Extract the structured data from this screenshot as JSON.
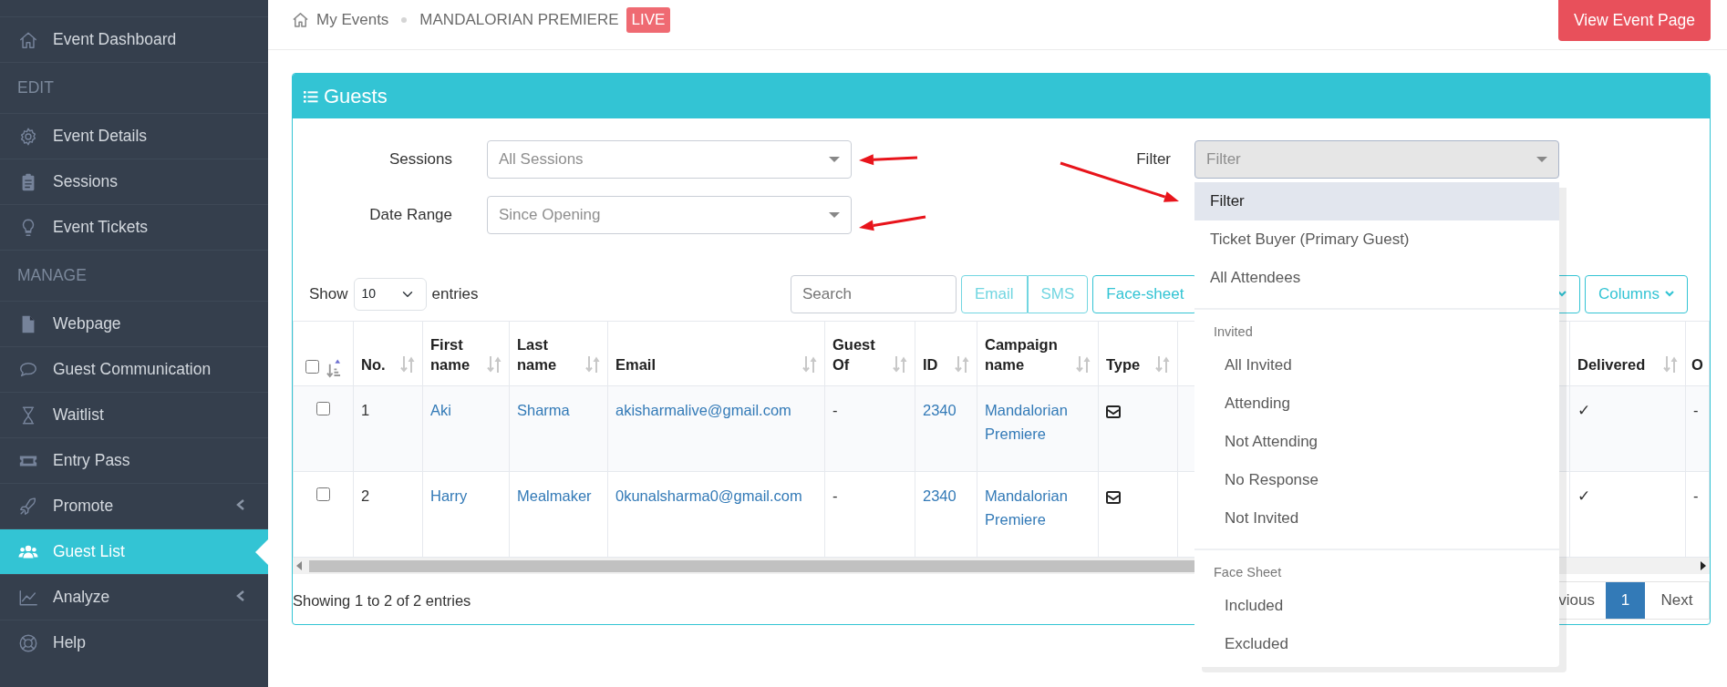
{
  "sidebar": {
    "items": [
      {
        "kind": "link",
        "label": "Event Dashboard",
        "selected": false,
        "submenu": false
      },
      {
        "kind": "heading",
        "label": "EDIT"
      },
      {
        "kind": "link",
        "label": "Event Details",
        "selected": false,
        "submenu": false
      },
      {
        "kind": "link",
        "label": "Sessions",
        "selected": false,
        "submenu": false
      },
      {
        "kind": "link",
        "label": "Event Tickets",
        "selected": false,
        "submenu": false
      },
      {
        "kind": "heading",
        "label": "MANAGE"
      },
      {
        "kind": "link",
        "label": "Webpage",
        "selected": false,
        "submenu": false
      },
      {
        "kind": "link",
        "label": "Guest Communication",
        "selected": false,
        "submenu": false
      },
      {
        "kind": "link",
        "label": "Waitlist",
        "selected": false,
        "submenu": false
      },
      {
        "kind": "link",
        "label": "Entry Pass",
        "selected": false,
        "submenu": false
      },
      {
        "kind": "link",
        "label": "Promote",
        "selected": false,
        "submenu": true
      },
      {
        "kind": "link",
        "label": "Guest List",
        "selected": true,
        "submenu": false
      },
      {
        "kind": "link",
        "label": "Analyze",
        "selected": false,
        "submenu": true
      },
      {
        "kind": "link",
        "label": "Help",
        "selected": false,
        "submenu": false
      }
    ]
  },
  "breadcrumb": {
    "items": [
      {
        "label": "My Events"
      },
      {
        "label": "MANDALORIAN PREMIERE"
      }
    ],
    "badge": "LIVE"
  },
  "header_button": "View Event Page",
  "card": {
    "title": "Guests",
    "selects": [
      {
        "label": "Sessions",
        "placeholder": "All Sessions"
      },
      {
        "label": "Date Range",
        "placeholder": "Since Opening"
      }
    ],
    "filter": {
      "label": "Filter",
      "placeholder": "Filter",
      "expanded": true,
      "groups": [
        {
          "options": [
            {
              "label": "Filter",
              "selected": true
            },
            {
              "label": "Ticket Buyer (Primary Guest)",
              "selected": false
            },
            {
              "label": "All Attendees",
              "selected": false
            }
          ]
        },
        {
          "header": "Invited",
          "options": [
            {
              "label": "All Invited",
              "selected": false
            },
            {
              "label": "Attending",
              "selected": false
            },
            {
              "label": "Not Attending",
              "selected": false
            },
            {
              "label": "No Response",
              "selected": false
            },
            {
              "label": "Not Invited",
              "selected": false
            }
          ]
        },
        {
          "header": "Face Sheet",
          "options": [
            {
              "label": "Included",
              "selected": false
            },
            {
              "label": "Excluded",
              "selected": false
            }
          ]
        }
      ]
    },
    "length": {
      "before": "Show",
      "value": "10",
      "after": "entries"
    },
    "search": {
      "placeholder": "Search"
    },
    "buttons": [
      {
        "kind": "grouped",
        "label": "Email"
      },
      {
        "kind": "grouped",
        "label": "SMS"
      },
      {
        "kind": "single",
        "label": "Face-sheet"
      },
      {
        "kind": "caret-only"
      },
      {
        "kind": "dropdown",
        "label": "Columns"
      }
    ],
    "table": {
      "select_all": {
        "checked": false
      },
      "columns": [
        {
          "kind": "text",
          "label": "No."
        },
        {
          "kind": "link",
          "label": "First name"
        },
        {
          "kind": "link",
          "label": "Last name"
        },
        {
          "kind": "link",
          "label": "Email"
        },
        {
          "kind": "text",
          "label": "Guest Of"
        },
        {
          "kind": "link",
          "label": "ID"
        },
        {
          "kind": "link",
          "label": "Campaign name"
        },
        {
          "kind": "icon",
          "label": "Type"
        },
        {
          "kind": "hidden"
        },
        {
          "kind": "text",
          "label": "Delivered"
        },
        {
          "kind": "text",
          "label": "O"
        }
      ],
      "rows": [
        {
          "checked": false,
          "cells": [
            "1",
            "Aki",
            "Sharma",
            "akisharmalive@gmail.com",
            "-",
            "2340",
            "Mandalorian Premiere",
            null,
            null,
            "✓",
            "-"
          ]
        },
        {
          "checked": false,
          "cells": [
            "2",
            "Harry",
            "Mealmaker",
            "0kunalsharma0@gmail.com",
            "-",
            "2340",
            "Mandalorian Premiere",
            null,
            null,
            "✓",
            "-"
          ]
        }
      ]
    },
    "info": "Showing 1 to 2 of 2 entries",
    "pagination": [
      {
        "label": "vious",
        "selected": false
      },
      {
        "label": "1",
        "selected": true
      },
      {
        "label": "Next",
        "selected": false
      }
    ]
  }
}
